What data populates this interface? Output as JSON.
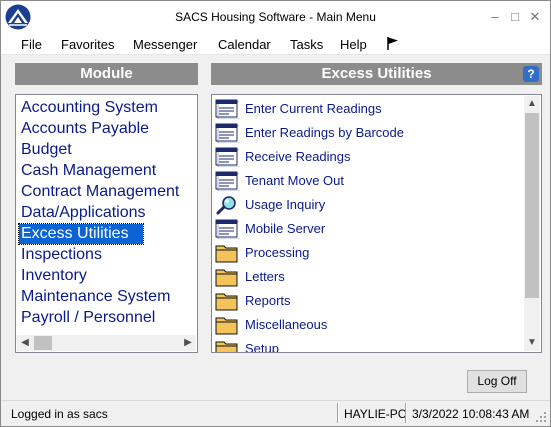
{
  "window": {
    "title": "SACS Housing Software - Main Menu",
    "minimize": "–",
    "maximize": "□",
    "close": "✕"
  },
  "menu": [
    "File",
    "Favorites",
    "Messenger",
    "Calendar",
    "Tasks",
    "Help"
  ],
  "module_panel": {
    "header": "Module",
    "items": [
      "Accounting System",
      "Accounts Payable",
      "Budget",
      "Cash Management",
      "Contract Management",
      "Data/Applications",
      "Excess Utilities",
      "Inspections",
      "Inventory",
      "Maintenance System",
      "Payroll / Personnel"
    ],
    "selected": "Excess Utilities"
  },
  "utilities_panel": {
    "header": "Excess Utilities",
    "help": "?",
    "items": [
      {
        "label": "Enter Current Readings",
        "icon": "form-icon"
      },
      {
        "label": "Enter Readings by Barcode",
        "icon": "form-icon"
      },
      {
        "label": "Receive Readings",
        "icon": "form-icon"
      },
      {
        "label": "Tenant Move Out",
        "icon": "form-icon"
      },
      {
        "label": "Usage Inquiry",
        "icon": "magnifier-icon"
      },
      {
        "label": "Mobile Server",
        "icon": "form-icon"
      },
      {
        "label": "Processing",
        "icon": "folder-icon"
      },
      {
        "label": "Letters",
        "icon": "folder-icon"
      },
      {
        "label": "Reports",
        "icon": "folder-icon"
      },
      {
        "label": "Miscellaneous",
        "icon": "folder-icon"
      },
      {
        "label": "Setup",
        "icon": "folder-icon"
      }
    ]
  },
  "buttons": {
    "logoff": "Log Off"
  },
  "status": {
    "user": "Logged in as sacs",
    "computer": "HAYLIE-PC",
    "datetime": "3/3/2022 10:08:43 AM"
  },
  "colors": {
    "accent": "#0a64d6",
    "link_text": "#0a1a8a",
    "header_bg": "#8c8c8c",
    "folder": "#f4c35a"
  }
}
